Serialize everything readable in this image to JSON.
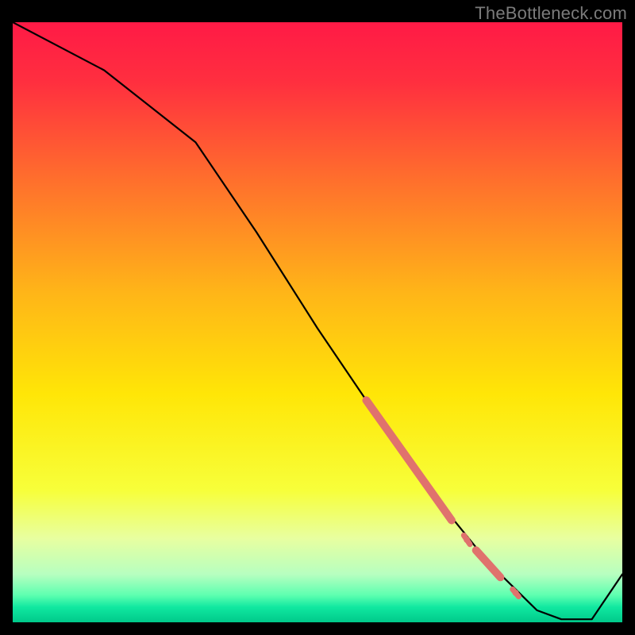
{
  "watermark": "TheBottleneck.com",
  "chart_data": {
    "type": "line",
    "title": "",
    "xlabel": "",
    "ylabel": "",
    "xlim": [
      0,
      100
    ],
    "ylim": [
      0,
      100
    ],
    "background_gradient_stops": [
      {
        "offset": 0.0,
        "color": "#ff1a46"
      },
      {
        "offset": 0.1,
        "color": "#ff2f3f"
      },
      {
        "offset": 0.25,
        "color": "#ff6a2e"
      },
      {
        "offset": 0.45,
        "color": "#ffb518"
      },
      {
        "offset": 0.62,
        "color": "#ffe607"
      },
      {
        "offset": 0.78,
        "color": "#f7ff3a"
      },
      {
        "offset": 0.86,
        "color": "#e8ffa0"
      },
      {
        "offset": 0.92,
        "color": "#b7ffc0"
      },
      {
        "offset": 0.955,
        "color": "#5dffb0"
      },
      {
        "offset": 0.975,
        "color": "#10e8a0"
      },
      {
        "offset": 1.0,
        "color": "#00c98a"
      }
    ],
    "series": [
      {
        "name": "bottleneck-curve",
        "color": "#000000",
        "x": [
          0,
          15,
          30,
          40,
          50,
          60,
          70,
          78,
          83,
          86,
          90,
          95,
          100
        ],
        "y": [
          100,
          92,
          80,
          65,
          49,
          34,
          20,
          10,
          5,
          2,
          0.5,
          0.5,
          8
        ]
      }
    ],
    "highlight_segments": {
      "color": "#e0726d",
      "width_thick": 10,
      "width_thin": 7,
      "segments": [
        {
          "x0": 58,
          "y0": 37,
          "x1": 72,
          "y1": 17,
          "w": "thick"
        },
        {
          "x0": 74,
          "y0": 14.5,
          "x1": 75,
          "y1": 13,
          "w": "thin",
          "dot": true
        },
        {
          "x0": 76,
          "y0": 12,
          "x1": 80,
          "y1": 7.5,
          "w": "thick"
        },
        {
          "x0": 82,
          "y0": 5.5,
          "x1": 83,
          "y1": 4.3,
          "w": "thin",
          "dot": true
        }
      ]
    }
  }
}
